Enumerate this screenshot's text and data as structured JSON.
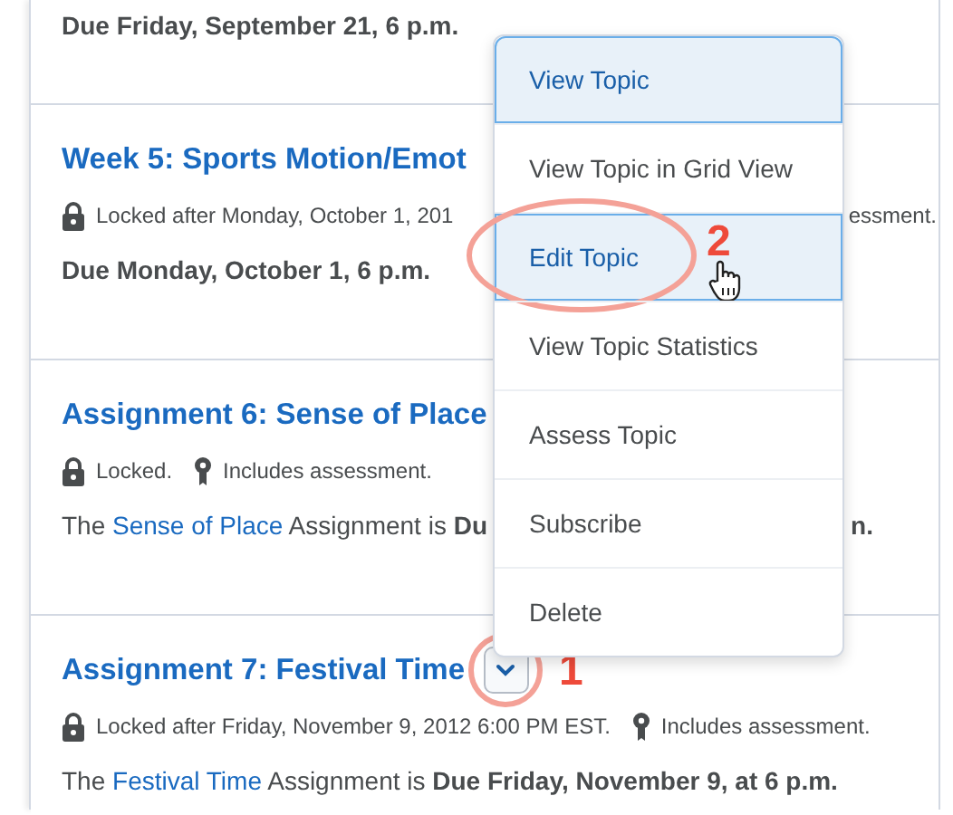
{
  "rows": [
    {
      "due": "Due Friday, September 21, 6 p.m."
    },
    {
      "title": "Week 5: Sports Motion/Emot",
      "meta": [
        {
          "kind": "lock",
          "text": "Locked after Monday, October 1, 201"
        }
      ],
      "meta_tail": "essment.",
      "due": "Due Monday, October 1, 6 p.m."
    },
    {
      "title": "Assignment 6: Sense of Place",
      "meta": [
        {
          "kind": "lock",
          "text": "Locked."
        },
        {
          "kind": "assessment",
          "text": "Includes assessment."
        }
      ],
      "body": [
        {
          "kind": "plain",
          "text": "The "
        },
        {
          "kind": "link",
          "text": "Sense of Place"
        },
        {
          "kind": "plain",
          "text": " Assignment is "
        },
        {
          "kind": "bold",
          "text": "Du"
        }
      ],
      "body_tail": "n."
    },
    {
      "title": "Assignment 7: Festival Time",
      "meta": [
        {
          "kind": "lock",
          "text": "Locked after Friday, November 9, 2012 6:00 PM EST."
        },
        {
          "kind": "assessment",
          "text": "Includes assessment."
        }
      ],
      "body": [
        {
          "kind": "plain",
          "text": "The "
        },
        {
          "kind": "link",
          "text": "Festival Time"
        },
        {
          "kind": "plain",
          "text": " Assignment is "
        },
        {
          "kind": "bold",
          "text": "Due Friday, November 9, at 6 p.m."
        }
      ],
      "menu_button": true,
      "callout": "1"
    }
  ],
  "menu": [
    {
      "label": "View Topic",
      "selected": true
    },
    {
      "label": "View Topic in Grid View",
      "selected": false
    },
    {
      "label": "Edit Topic",
      "selected": true,
      "callout": "2"
    },
    {
      "label": "View Topic Statistics",
      "selected": false
    },
    {
      "label": "Assess Topic",
      "selected": false
    },
    {
      "label": "Subscribe",
      "selected": false
    },
    {
      "label": "Delete",
      "selected": false
    }
  ]
}
